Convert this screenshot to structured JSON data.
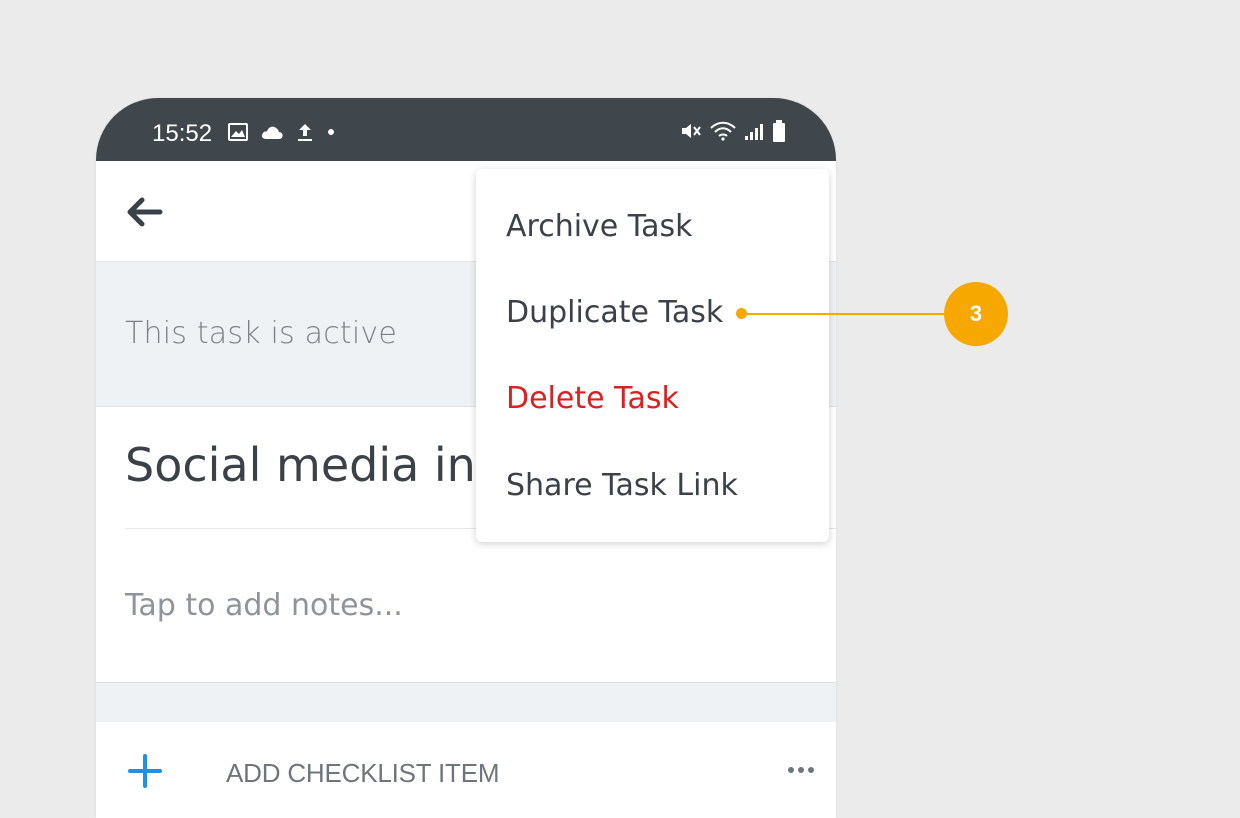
{
  "status_bar": {
    "time": "15:52"
  },
  "banner": {
    "text": "This task is active"
  },
  "task": {
    "title": "Social media inte",
    "notes_placeholder": "Tap to add notes..."
  },
  "checklist": {
    "add_label": "ADD CHECKLIST ITEM"
  },
  "menu": {
    "items": [
      {
        "label": "Archive Task"
      },
      {
        "label": "Duplicate Task"
      },
      {
        "label": "Delete Task"
      },
      {
        "label": "Share Task Link"
      }
    ]
  },
  "callout": {
    "number": "3"
  },
  "colors": {
    "accent": "#f7a800",
    "danger": "#dc1f1f",
    "add_blue": "#1e90e6",
    "status_bar": "#3f464c"
  },
  "icons": [
    "image-icon",
    "cloud-icon",
    "upload-icon",
    "mute-icon",
    "wifi-icon",
    "signal-icon",
    "battery-icon",
    "back-arrow-icon",
    "plus-icon",
    "more-icon"
  ]
}
